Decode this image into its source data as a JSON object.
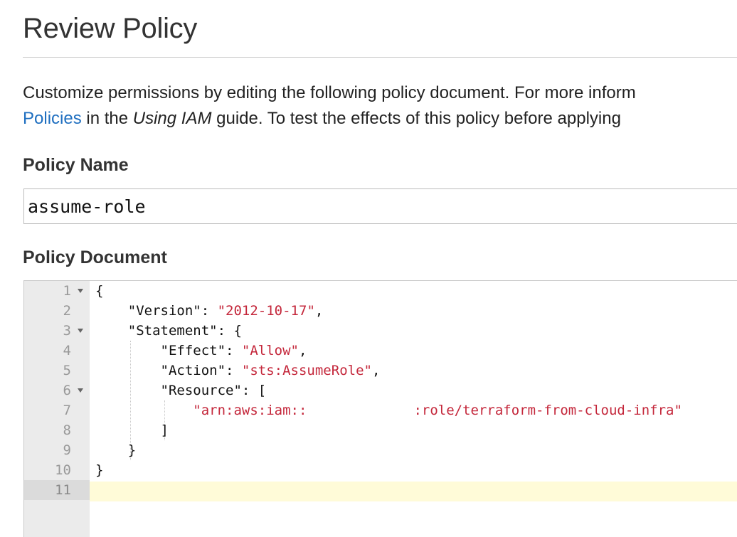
{
  "page": {
    "title": "Review Policy"
  },
  "description": {
    "line1": "Customize permissions by editing the following policy document. For more inform",
    "link_text": "Policies",
    "line2_part1": " in the ",
    "guide_italic": "Using IAM",
    "line2_part2": " guide. To test the effects of this policy before applying"
  },
  "policy_name": {
    "label": "Policy Name",
    "value": "assume-role"
  },
  "policy_document": {
    "label": "Policy Document",
    "line_numbers": [
      "1",
      "2",
      "3",
      "4",
      "5",
      "6",
      "7",
      "8",
      "9",
      "10",
      "11"
    ],
    "active_line": "11",
    "lines": {
      "l1": {
        "open": "{"
      },
      "l2": {
        "key": "\"Version\"",
        "sep": ": ",
        "value": "\"2012-10-17\"",
        "end": ","
      },
      "l3": {
        "key": "\"Statement\"",
        "sep": ": ",
        "end": "{"
      },
      "l4": {
        "key": "\"Effect\"",
        "sep": ": ",
        "value": "\"Allow\"",
        "end": ","
      },
      "l5": {
        "key": "\"Action\"",
        "sep": ": ",
        "value": "\"sts:AssumeRole\"",
        "end": ","
      },
      "l6": {
        "key": "\"Resource\"",
        "sep": ": ",
        "end": "["
      },
      "l7": {
        "value_a": "\"arn:aws:iam::",
        "value_b": ":role/terraform-from-cloud-infra\""
      },
      "l8": {
        "close": "]"
      },
      "l9": {
        "close": "}"
      },
      "l10": {
        "close": "}"
      }
    }
  },
  "colors": {
    "link": "#1f6fc0",
    "string": "#c4273b",
    "gutter": "#ebebeb",
    "active_line": "#fffbd8"
  }
}
